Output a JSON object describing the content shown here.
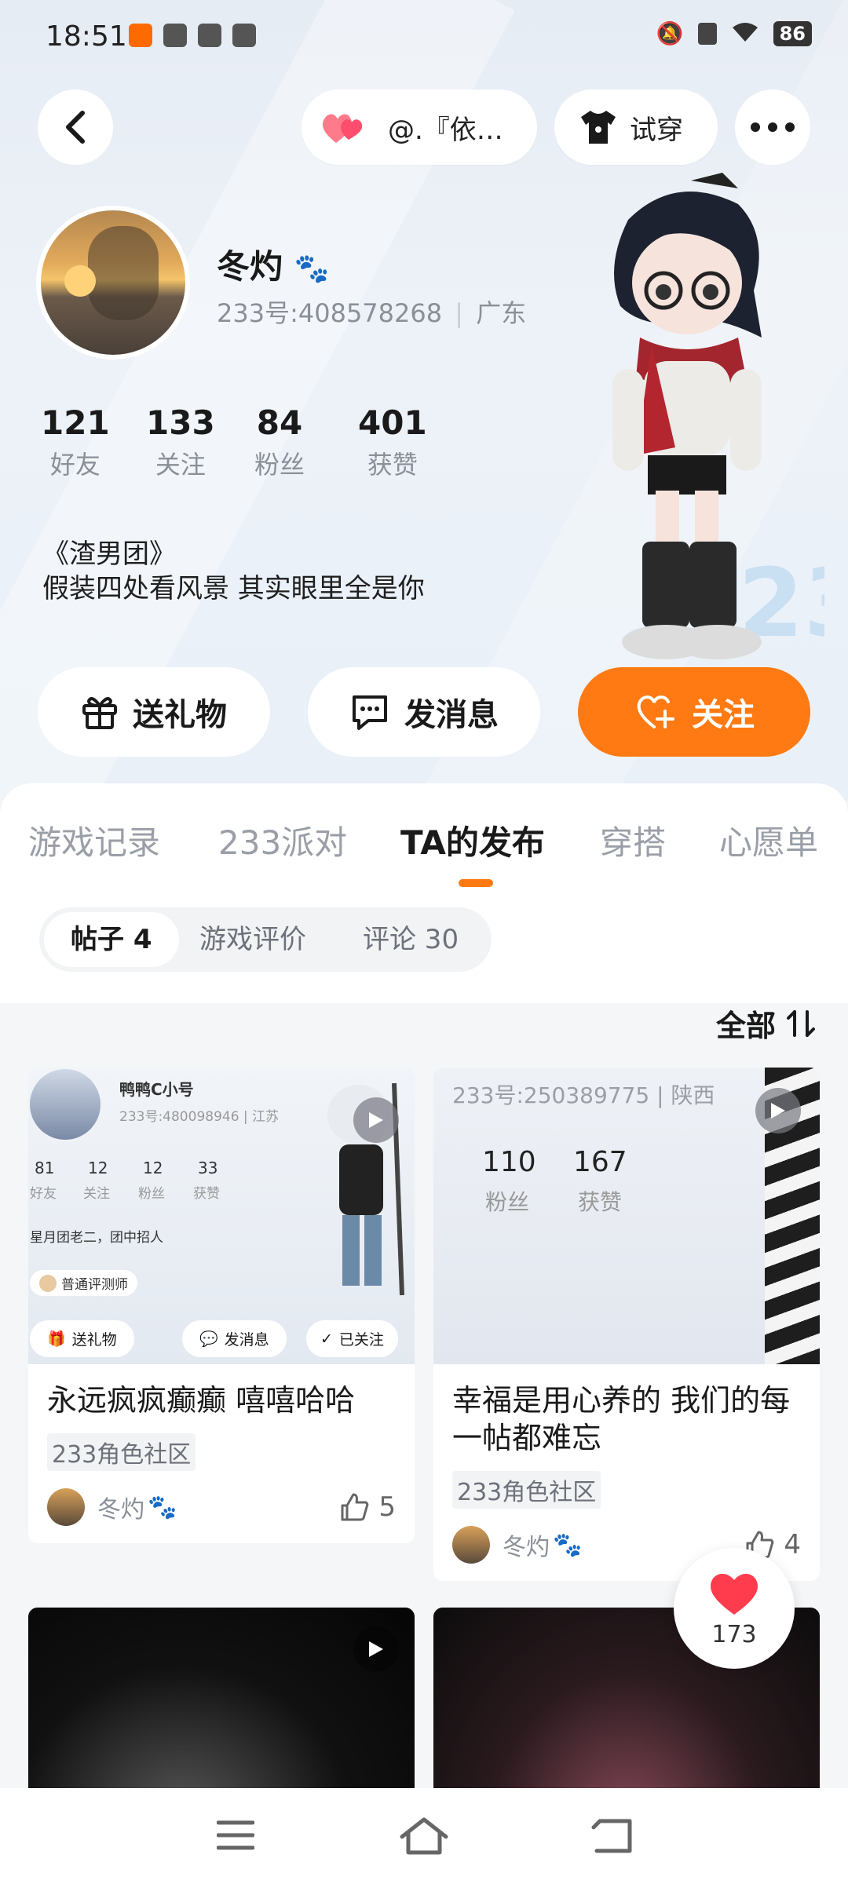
{
  "status_bar": {
    "time": "18:51",
    "battery": "86"
  },
  "top_nav": {
    "back_icon": "back-arrow-icon",
    "companion_label": "@.『依…",
    "tryon_label": "试穿",
    "more_icon": "more-dots-icon"
  },
  "profile": {
    "name": "冬灼",
    "id_text": "233号:408578268",
    "region": "广东",
    "stats": [
      {
        "num": "121",
        "label": "好友"
      },
      {
        "num": "133",
        "label": "关注"
      },
      {
        "num": "84",
        "label": "粉丝"
      },
      {
        "num": "401",
        "label": "获赞"
      }
    ],
    "bio_line1": "《渣男团》",
    "bio_line2": "假装四处看风景  其实眼里全是你"
  },
  "actions": {
    "gift": "送礼物",
    "message": "发消息",
    "follow": "关注"
  },
  "tabs": [
    {
      "label": "游戏记录"
    },
    {
      "label": "233派对"
    },
    {
      "label": "TA的发布"
    },
    {
      "label": "穿搭"
    },
    {
      "label": "心愿单"
    }
  ],
  "subtabs": [
    {
      "label": "帖子 4"
    },
    {
      "label": "游戏评价"
    },
    {
      "label": "评论 30"
    }
  ],
  "sort_label": "全部",
  "posts": [
    {
      "title": "永远疯疯癫癫   嘻嘻哈哈",
      "tag": "233角色社区",
      "author": "冬灼",
      "likes": "5",
      "preview": {
        "name": "鸭鸭C小号",
        "id": "233号:480098946 | 江苏",
        "stats": [
          {
            "num": "81",
            "label": "好友"
          },
          {
            "num": "12",
            "label": "关注"
          },
          {
            "num": "12",
            "label": "粉丝"
          },
          {
            "num": "33",
            "label": "获赞"
          }
        ],
        "bio": "星月团老二，团中招人",
        "badge": "普通评测师",
        "gift": "送礼物",
        "message": "发消息",
        "followed": "已关注"
      }
    },
    {
      "title": "幸福是用心养的  我们的每一帖都难忘",
      "tag": "233角色社区",
      "author": "冬灼",
      "likes": "4",
      "preview": {
        "id": "233号:250389775 | 陕西",
        "stat_a_num": "110",
        "stat_a_label": "粉丝",
        "stat_b_num": "167",
        "stat_b_label": "获赞"
      }
    }
  ],
  "float_like_count": "173",
  "colors": {
    "accent": "#ff7a12",
    "like_red": "#ff3b4e"
  }
}
